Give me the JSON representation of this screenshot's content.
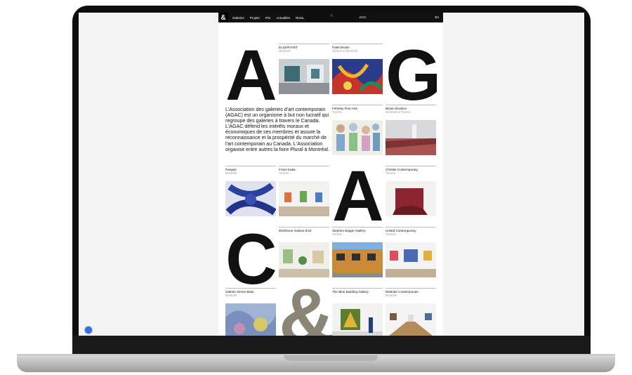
{
  "nav": {
    "logo": "&",
    "links": [
      "Galeries",
      "Projets",
      "Prix",
      "Actualités",
      "Ressources"
    ],
    "brand": "AGAC",
    "lang": "En"
  },
  "letters": {
    "a1": "A",
    "g": "G",
    "a2": "A",
    "c": "C",
    "amp": "&"
  },
  "blurb": "L'Association des galeries d'art contemporain (AGAC) est un organisme à but non lucratif qui regroupe des galeries à travers le Canada. L'AGAC défend les intérêts moraux et économiques de ses membres et assure la reconnaissance et la prospérité du marché de l'art contemporain au Canada. L'Association organise entre autres la foire Plural à Montréal.",
  "galleries": [
    {
      "name": "ELLEPHANT",
      "city": "Montréal"
    },
    {
      "name": "Patel Brown",
      "city": "Toronto et Montréal"
    },
    {
      "name": "Feheley Fine Arts",
      "city": "Toronto"
    },
    {
      "name": "Blouin Division",
      "city": "Montréal et Toronto"
    },
    {
      "name": "Pangée",
      "city": "Montréal"
    },
    {
      "name": "Franz Kaka",
      "city": "Toronto"
    },
    {
      "name": "Christie Contemporary",
      "city": "Toronto"
    },
    {
      "name": "Wishbone Galerie d'art",
      "city": ""
    },
    {
      "name": "Stephen Bulger Gallery",
      "city": "Toronto"
    },
    {
      "name": "United Contemporary",
      "city": "Toronto"
    },
    {
      "name": "Galerie Simon Blais",
      "city": "Montréal"
    },
    {
      "name": "The Blue Building Gallery",
      "city": ""
    },
    {
      "name": "McBride Contemporain",
      "city": "Montréal"
    }
  ],
  "help_icon": "help-bubble-icon"
}
